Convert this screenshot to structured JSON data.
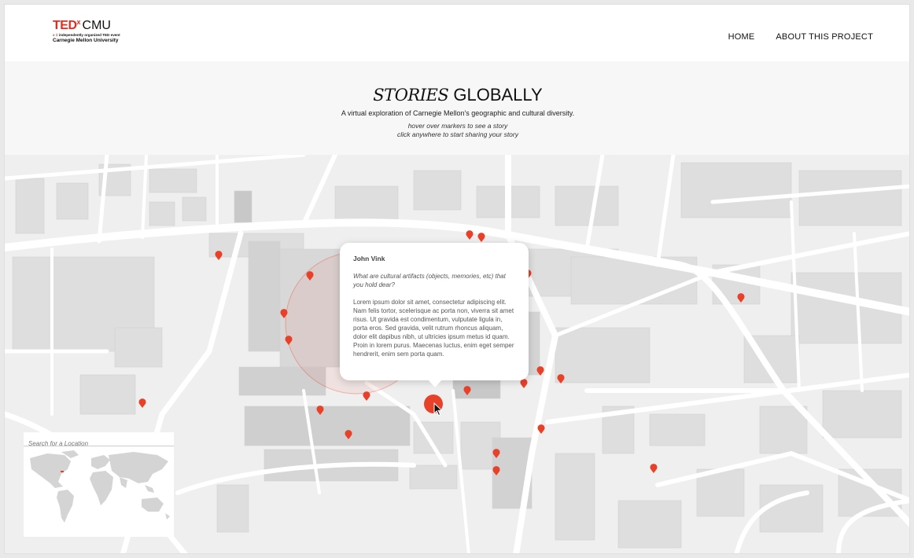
{
  "logo": {
    "ted": "TED",
    "x": "x",
    "cmu": "CMU",
    "sub_x": "x",
    "sub_text": " = independently organized TED event",
    "university": "Carnegie Mellon University"
  },
  "nav": {
    "home": "HOME",
    "about": "ABOUT THIS PROJECT"
  },
  "hero": {
    "title_italic": "STORIES",
    "title_caps": "GLOBALLY",
    "subtitle": "A virtual exploration of Carnegie Mellon's geographic and cultural diversity.",
    "hint_line1": "hover over markers to see a story",
    "hint_line2": "click anywhere to start sharing your story"
  },
  "popup": {
    "name": "John Vink",
    "question": "What are cultural artifacts (objects, memories, etc) that you hold dear?",
    "body": "Lorem ipsum dolor sit amet, consectetur adipiscing elit. Nam felis tortor, scelerisque ac porta non, viverra sit amet risus. Ut gravida est condimentum, vulputate ligula in, porta eros. Sed gravida, velit rutrum rhoncus aliquam, dolor elit dapibus nibh, ut ultricies ipsum metus id quam. Proin in lorem purus. Maecenas luctus, enim eget semper hendrerit, enim sem porta quam."
  },
  "minimap": {
    "search_placeholder": "Search for a Location"
  },
  "colors": {
    "accent": "#e8412a",
    "ted_red": "#e62b1e",
    "map_bg": "#efefef",
    "road": "#ffffff",
    "building": "#d6d6d6"
  },
  "icons": {
    "marker": "map-pin-icon",
    "cursor": "pointer-cursor-icon"
  }
}
